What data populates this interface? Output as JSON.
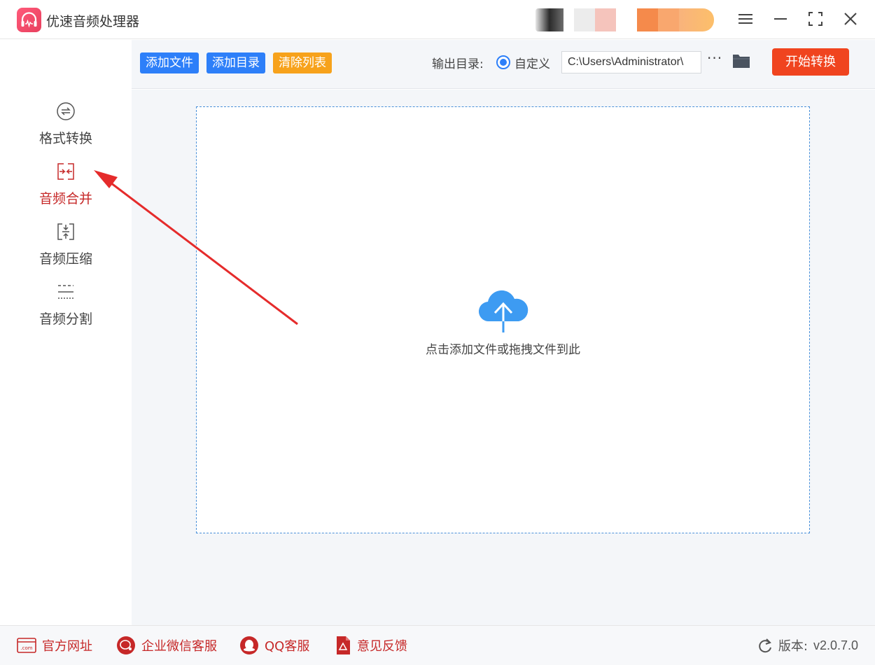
{
  "app": {
    "title": "优速音频处理器"
  },
  "sidebar": {
    "items": [
      {
        "label": "格式转换",
        "icon": "format-convert-icon",
        "active": false
      },
      {
        "label": "音频合并",
        "icon": "merge-icon",
        "active": true
      },
      {
        "label": "音频压缩",
        "icon": "compress-icon",
        "active": false
      },
      {
        "label": "音频分割",
        "icon": "split-icon",
        "active": false
      }
    ]
  },
  "toolbar": {
    "add_file": "添加文件",
    "add_folder": "添加目录",
    "clear_list": "清除列表",
    "output_label": "输出目录:",
    "custom_label": "自定义",
    "output_path": "C:\\Users\\Administrator\\",
    "more_label": "···",
    "start_label": "开始转换"
  },
  "main": {
    "drop_text": "点击添加文件或拖拽文件到此"
  },
  "footer": {
    "website": "官方网址",
    "wechat": "企业微信客服",
    "qq": "QQ客服",
    "feedback": "意见反馈",
    "version_label": "版本:",
    "version_value": "v2.0.7.0"
  },
  "colors": {
    "accent_blue": "#2d7ff9",
    "clear_orange": "#f7a21b",
    "start_red": "#f0441f",
    "active_red": "#c62828",
    "cloud_blue": "#3d9bf2"
  }
}
